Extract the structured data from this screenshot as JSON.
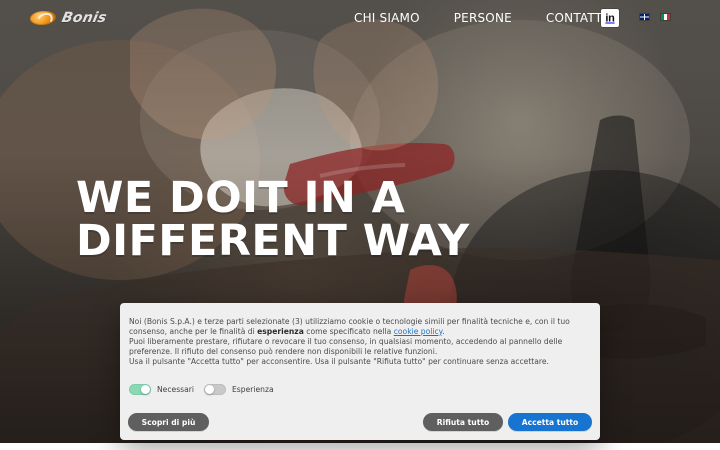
{
  "nav": {
    "items": [
      "CHI SIAMO",
      "PERSONE",
      "CONTATTI"
    ],
    "social_label": "in",
    "languages": [
      "en",
      "it"
    ]
  },
  "hero": {
    "headline": [
      "WE DOIT IN A",
      "DIFFERENT WAY"
    ]
  },
  "cookie": {
    "text": [
      {
        "before": "Noi (Bonis S.p.A.) e terze parti selezionate (3) utilizziamo cookie o tecnologie simili per finalità tecniche e, con il tuo consenso, anche per le finalità di ",
        "strong": "esperienza",
        "middle": " come specificato nella ",
        "link": "cookie policy",
        "after": "."
      },
      "Puoi liberamente prestare, rifiutare o revocare il tuo consenso, in qualsiasi momento, accedendo al pannello delle preferenze. Il rifiuto del consenso può rendere non disponibili le relative funzioni.",
      "Usa il pulsante \"Accetta tutto\" per acconsentire. Usa il pulsante \"Rifiuta tutto\" per continuare senza accettare."
    ],
    "toggles": [
      {
        "label": "Necessari",
        "state": "on"
      },
      {
        "label": "Esperienza",
        "state": "off"
      }
    ],
    "buttons": {
      "learn": "Scopri di più",
      "reject": "Rifiuta tutto",
      "accept": "Accetta tutto"
    },
    "colors": {
      "accent": "#1874d1",
      "neutral": "#5f5f5f",
      "toggle_on": "#88d9b5",
      "toggle_off": "#c9c9c9"
    }
  },
  "brand": {
    "logo_text": "Bonis"
  }
}
